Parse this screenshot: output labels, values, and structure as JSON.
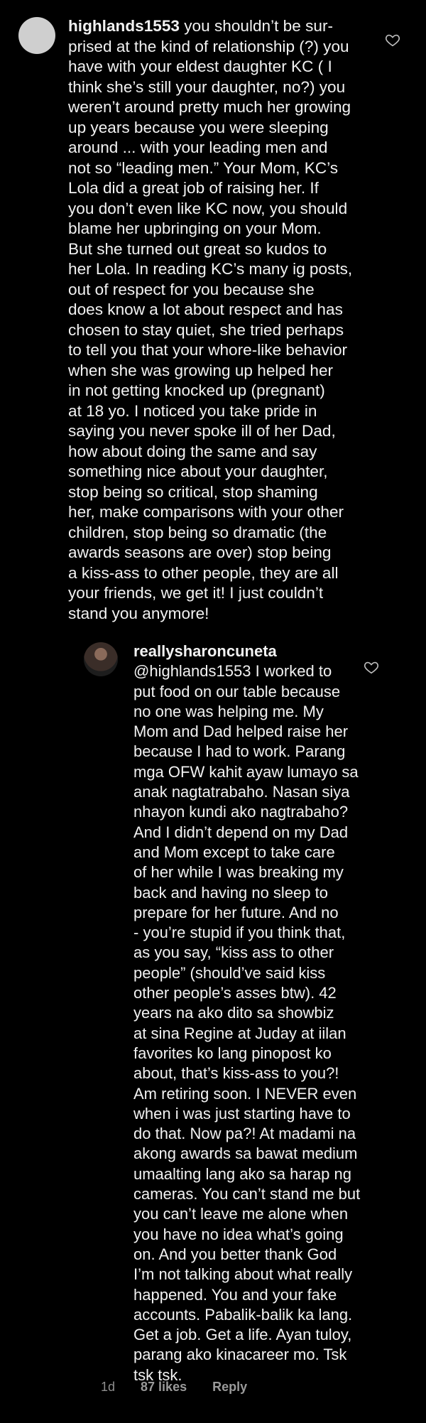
{
  "comment1": {
    "username": "highlands1553",
    "text": "you shouldn’t be sur-\nprised at the kind of relationship (?) you\nhave with your eldest daughter KC ( I\nthink she’s still your daughter, no?) you\nweren’t around pretty much her growing\nup years because you were sleeping\naround ... with your leading men and\nnot so “leading men.” Your Mom, KC’s\nLola did a great job of raising her.  If\nyou don’t even like KC now, you should\nblame her upbringing on your Mom.\nBut she turned out great so kudos to\nher Lola.  In reading KC’s many ig posts,\nout of respect for you because she\ndoes know a lot about respect and has\nchosen to stay quiet, she tried perhaps\nto tell you that your whore-like behavior\nwhen she was growing up helped her\nin not getting knocked up (pregnant)\nat 18 yo.  I noticed you take pride in\nsaying you never spoke ill of her Dad,\nhow about doing the same and say\nsomething nice about your daughter,\nstop being so critical, stop shaming\nher, make comparisons with your other\nchildren, stop being so dramatic (the\nawards seasons are over) stop being\na kiss-ass to other people, they are all\nyour friends, we get it!  I just couldn’t\nstand you anymore!"
  },
  "reply": {
    "username": "reallysharoncuneta",
    "text": "@highlands1553 I worked to\nput food on our table because\nno one was helping me. My\nMom and Dad helped raise her\nbecause I had to work. Parang\nmga OFW kahit ayaw lumayo sa\nanak nagtatrabaho. Nasan siya\nnhayon kundi ako nagtrabaho?\nAnd I didn’t depend on my Dad\nand Mom except to take care\nof her while I was breaking my\nback and having no sleep to\nprepare for her future. And no\n- you’re stupid if you think that,\nas you say, “kiss ass to other\npeople” (should’ve said kiss\nother people’s asses btw). 42\nyears na ako dito sa showbiz\nat sina Regine at Juday at iilan\nfavorites ko lang pinopost ko\nabout, that’s kiss-ass to you?!\nAm retiring soon. I NEVER even\nwhen i was just starting have to\ndo that. Now pa?! At madami na\nakong awards sa bawat medium\numaalting lang ako sa harap ng\ncameras. You can’t stand me but\nyou can’t leave me alone when\nyou have no idea what’s going\non. And you better thank God\nI’m not talking about what really\nhappened. You and your fake\naccounts. Pabalik-balik ka lang.\nGet a job. Get a life. Ayan tuloy,\nparang ako kinacareer mo. Tsk\ntsk tsk.",
    "time": "1d",
    "likes": "87 likes",
    "reply_label": "Reply"
  },
  "icons": {
    "like": "heart-icon"
  }
}
